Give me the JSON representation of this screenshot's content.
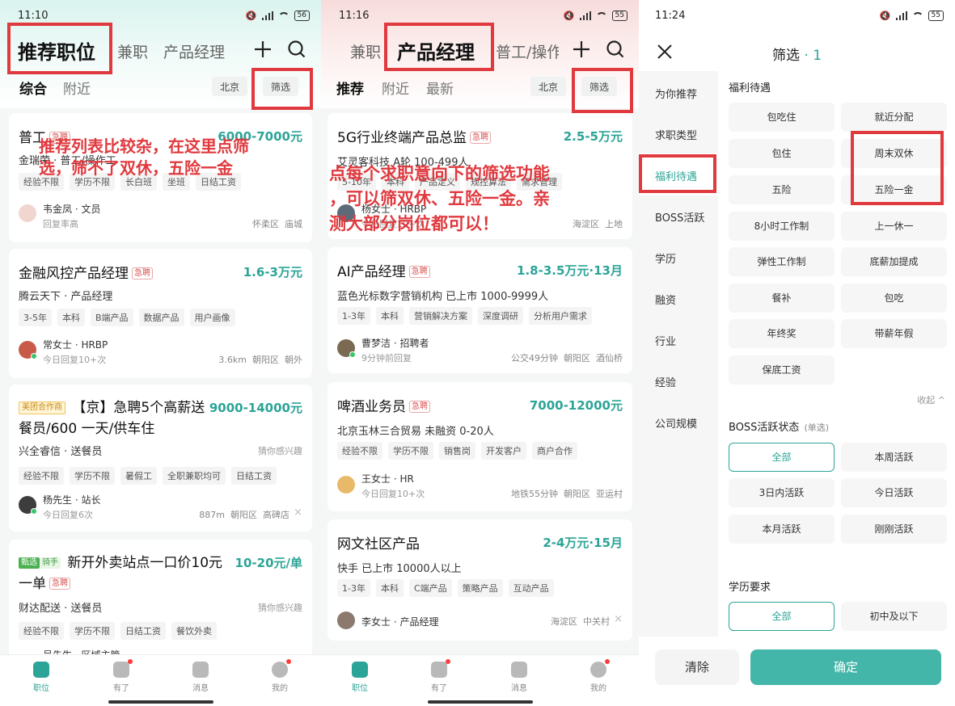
{
  "colors": {
    "accent": "#2ca497",
    "annotation": "#e0393e",
    "urgent": "#d85656",
    "ok_button": "#44b6a9"
  },
  "icons": [
    "plus-icon",
    "search-icon",
    "close-icon",
    "signal-icon",
    "wifi-icon",
    "battery-icon",
    "bag-icon",
    "book-icon",
    "chat-icon",
    "face-icon"
  ],
  "panel1": {
    "status": {
      "time": "11:10",
      "battery": "56"
    },
    "nav": {
      "active": "推荐职位",
      "tab2": "兼职",
      "tab3": "产品经理"
    },
    "subnav": {
      "tab1": "综合",
      "tab2": "附近",
      "city": "北京",
      "filter": "筛选"
    },
    "annotation": {
      "line1": "推荐列表比较杂，在这里点筛",
      "line2": "选，筛不了双休，五险一金"
    },
    "cards": [
      {
        "title": "普工",
        "urgent": "急聘",
        "salary": "6000-7000元",
        "company": "金瑞荣 · 普工/操作工",
        "tags": [
          "经验不限",
          "学历不限",
          "长白班",
          "坐班",
          "日结工资"
        ],
        "recruiter": "韦金凤 · 文员",
        "reply": "回复率高",
        "loc1": "怀柔区",
        "loc2": "庙城"
      },
      {
        "title": "金融风控产品经理",
        "urgent": "急聘",
        "salary": "1.6-3万元",
        "company": "腾云天下 · 产品经理",
        "tags": [
          "3-5年",
          "本科",
          "B端产品",
          "数据产品",
          "用户画像"
        ],
        "recruiter": "常女士 · HRBP",
        "reply": "今日回复10+次",
        "distance": "3.6km",
        "loc1": "朝阳区",
        "loc2": "朝外"
      },
      {
        "badge": "美团合作商",
        "title_line1": "【京】急聘5个高薪送",
        "title_line2": "餐员/600 一天/供车住",
        "salary": "9000-14000元",
        "company": "兴全睿信 · 送餐员",
        "interest": "猜你感兴趣",
        "tags": [
          "经验不限",
          "学历不限",
          "暑假工",
          "全职兼职均可",
          "日结工资"
        ],
        "recruiter": "杨先生 · 站长",
        "reply": "今日回复6次",
        "distance": "887m",
        "loc1": "朝阳区",
        "loc2": "高碑店",
        "close": "×"
      },
      {
        "badge1": "甄选",
        "badge2": "骑手",
        "title_line1": "新开外卖站点一口价10元",
        "title_line2": "一单",
        "urgent": "急聘",
        "salary": "10-20元/单",
        "company": "财达配送 · 送餐员",
        "interest": "猜你感兴趣",
        "tags": [
          "经验不限",
          "学历不限",
          "日结工资",
          "餐饮外卖"
        ],
        "recruiter": "吴先生 · 区域主管"
      }
    ],
    "bottom": [
      "职位",
      "有了",
      "消息",
      "我的"
    ]
  },
  "panel2": {
    "status": {
      "time": "11:16",
      "battery": "55"
    },
    "nav": {
      "tab1": "兼职",
      "active": "产品经理",
      "tab3": "普工/操作"
    },
    "subnav": {
      "tab1": "推荐",
      "tab2": "附近",
      "tab3": "最新",
      "city": "北京",
      "filter": "筛选"
    },
    "annotation": {
      "line1": "点每个求职意向下的筛选功能",
      "line2": "，可以筛双休、五险一金。亲",
      "line3": "测大部分岗位都可以！"
    },
    "cards": [
      {
        "title": "5G行业终端产品总监",
        "urgent": "急聘",
        "salary": "2.5-5万元",
        "company": "艾灵客科技 A轮 100-499人",
        "tags": [
          "5-10年",
          "本科",
          "产品定义",
          "规控算法",
          "需求管理"
        ],
        "recruiter": "杨女士 · HRBP",
        "reply": "今日回复10+次",
        "loc1": "海淀区",
        "loc2": "上地"
      },
      {
        "title": "AI产品经理",
        "urgent": "急聘",
        "salary": "1.8-3.5万元·13月",
        "company": "蓝色光标数字营销机构 已上市 1000-9999人",
        "tags": [
          "1-3年",
          "本科",
          "营销解决方案",
          "深度调研",
          "分析用户需求"
        ],
        "recruiter": "曹梦洁 · 招聘者",
        "reply": "9分钟前回复",
        "commute": "公交49分钟",
        "loc1": "朝阳区",
        "loc2": "酒仙桥"
      },
      {
        "title": "啤酒业务员",
        "urgent": "急聘",
        "salary": "7000-12000元",
        "company": "北京玉林三合贸易 未融资 0-20人",
        "tags": [
          "经验不限",
          "学历不限",
          "销售岗",
          "开发客户",
          "商户合作"
        ],
        "recruiter": "王女士 · HR",
        "reply": "今日回复10+次",
        "commute": "地铁55分钟",
        "loc1": "朝阳区",
        "loc2": "亚运村"
      },
      {
        "title": "网文社区产品",
        "salary": "2-4万元·15月",
        "company": "快手 已上市 10000人以上",
        "tags": [
          "1-3年",
          "本科",
          "C端产品",
          "策略产品",
          "互动产品"
        ],
        "recruiter": "李女士 · 产品经理",
        "loc1": "海淀区",
        "loc2": "中关村",
        "close": "×"
      }
    ],
    "bottom": [
      "职位",
      "有了",
      "消息",
      "我的"
    ]
  },
  "panel3": {
    "status": {
      "time": "11:24",
      "battery": "55"
    },
    "title": "筛选",
    "count": "· 1",
    "sidebar": [
      "为你推荐",
      "求职类型",
      "福利待遇",
      "BOSS活跃",
      "学历",
      "融资",
      "行业",
      "经验",
      "公司规模"
    ],
    "sidebar_active": "福利待遇",
    "welfare": {
      "title": "福利待遇",
      "options": [
        "包吃住",
        "就近分配",
        "包住",
        "周末双休",
        "五险",
        "五险一金",
        "8小时工作制",
        "上一休一",
        "弹性工作制",
        "底薪加提成",
        "餐补",
        "包吃",
        "年终奖",
        "带薪年假",
        "保底工资"
      ]
    },
    "collapse": "收起 ^",
    "boss": {
      "title": "BOSS活跃状态",
      "sub": "(单选)",
      "options": [
        "全部",
        "本周活跃",
        "3日内活跃",
        "今日活跃",
        "本月活跃",
        "刚刚活跃"
      ]
    },
    "education": {
      "title": "学历要求",
      "options": [
        "全部",
        "初中及以下"
      ]
    },
    "footer": {
      "clear": "清除",
      "confirm": "确定"
    }
  }
}
